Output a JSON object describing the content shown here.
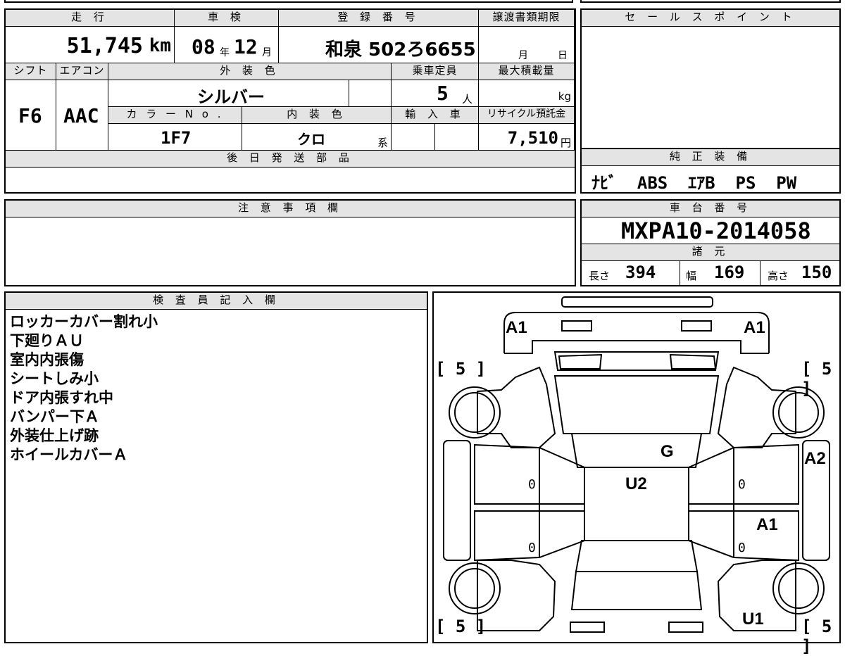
{
  "vehicle": {
    "mileage_label": "走 行",
    "mileage_value": "51,745",
    "mileage_unit": "km",
    "inspection_label": "車 検",
    "inspection_year": "08",
    "year_unit": "年",
    "inspection_month": "12",
    "month_unit": "月",
    "registration_label": "登 録 番 号",
    "registration_value": "和泉 502ろ6655",
    "transfer_label": "譲渡書類期限",
    "transfer_month_unit": "月",
    "transfer_day_unit": "日",
    "shift_label": "シフト",
    "shift_value": "F6",
    "aircon_label": "エアコン",
    "aircon_value": "AAC",
    "exterior_label": "外 装 色",
    "exterior_value": "シルバー",
    "capacity_label": "乗車定員",
    "capacity_value": "5",
    "capacity_unit": "人",
    "load_label": "最大積載量",
    "load_unit": "kg",
    "color_no_label": "カ ラ ー N o .",
    "color_no_value": "1F7",
    "interior_label": "内 装 色",
    "interior_value": "クロ",
    "interior_suffix": "系",
    "import_label": "輸 入 車",
    "recycle_label": "リサイクル預託金",
    "recycle_value": "7,510",
    "recycle_unit": "円",
    "later_parts_label": "後 日 発 送 部 品"
  },
  "sales_point": {
    "label": "セ ー ル ス ポ イ ン ト"
  },
  "equipment": {
    "label": "純 正 装 備",
    "value": "ﾅﾋﾞ  ABS  ｴｱB  PS  PW"
  },
  "caution": {
    "label": "注 意 事 項 欄"
  },
  "chassis": {
    "label": "車 台 番 号",
    "value": "MXPA10-2014058"
  },
  "specs": {
    "label": "諸 元",
    "length_label": "長さ",
    "length_value": "394",
    "width_label": "幅",
    "width_value": "169",
    "height_label": "高さ",
    "height_value": "150"
  },
  "inspector": {
    "label": "検 査 員 記 入 欄",
    "notes": [
      "ロッカーカバー割れ小",
      "下廻りＡＵ",
      "室内内張傷",
      "シートしみ小",
      "ドア内張すれ中",
      "バンパー下Ａ",
      "外装仕上げ跡",
      "ホイールカバーＡ"
    ]
  },
  "diagram": {
    "marks": {
      "front_left": "A1",
      "front_right": "A1",
      "roof": "G",
      "center": "U2",
      "right_panel": "A2",
      "right_door": "A1",
      "rear_right": "U1"
    },
    "tires": {
      "front_left": "[ 5 ]",
      "front_right": "[ 5 ]",
      "rear_left": "[ 5 ]",
      "rear_right": "[ 5 ]"
    },
    "zero_marks": [
      "0",
      "0",
      "0",
      "0"
    ]
  }
}
